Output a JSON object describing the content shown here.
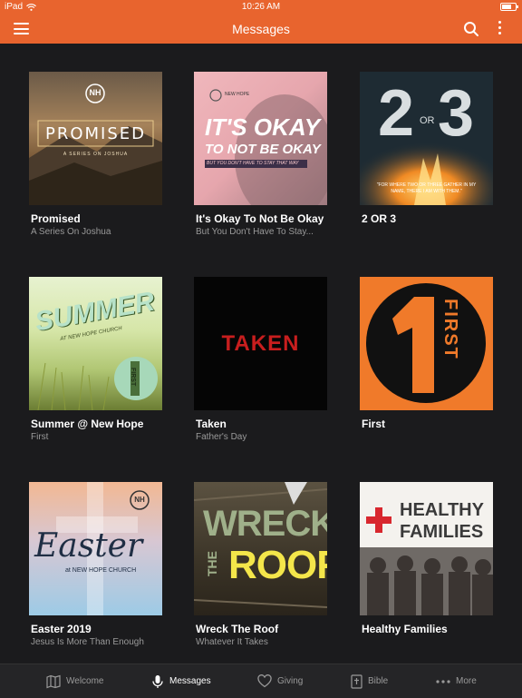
{
  "status_bar": {
    "device": "iPad",
    "time": "10:26 AM"
  },
  "header": {
    "title": "Messages"
  },
  "messages": [
    {
      "title": "Promised",
      "subtitle": "A Series On Joshua",
      "art_text": "PROMISED",
      "art_sub": "A SERIES ON JOSHUA",
      "logo": "NH"
    },
    {
      "title": "It's Okay To Not Be Okay",
      "subtitle": "But You Don't Have To Stay...",
      "art_text_1": "IT'S OKAY",
      "art_text_2": "TO NOT BE OKAY",
      "art_sub": "BUT YOU DON'T HAVE TO STAY THAT WAY",
      "logo_text": "NEW HOPE"
    },
    {
      "title": "2 OR 3",
      "subtitle": "",
      "art_num1": "2",
      "art_or": "OR",
      "art_num2": "3",
      "art_quote": "\"FOR WHERE TWO OR THREE GATHER IN MY NAME, THERE I AM WITH THEM.\""
    },
    {
      "title": "Summer @ New Hope",
      "subtitle": "First",
      "art_text": "SUMMER",
      "art_sub": "AT NEW HOPE CHURCH",
      "art_first": "FIRST"
    },
    {
      "title": "Taken",
      "subtitle": "Father's Day",
      "art_text": "TAKEN"
    },
    {
      "title": "First",
      "subtitle": "",
      "art_text": "FIRST"
    },
    {
      "title": "Easter 2019",
      "subtitle": "Jesus Is More Than Enough",
      "art_text": "Easter",
      "art_sub": "at NEW HOPE CHURCH",
      "logo": "NH"
    },
    {
      "title": "Wreck The Roof",
      "subtitle": "Whatever It Takes",
      "art_w1": "WRECK",
      "art_w2": "THE",
      "art_w3": "ROOF"
    },
    {
      "title": "Healthy Families",
      "subtitle": "",
      "art_w1": "HEALTHY",
      "art_w2": "FAMILIES"
    }
  ],
  "tabs": [
    {
      "label": "Welcome",
      "icon": "map-icon",
      "active": false
    },
    {
      "label": "Messages",
      "icon": "microphone-icon",
      "active": true
    },
    {
      "label": "Giving",
      "icon": "heart-icon",
      "active": false
    },
    {
      "label": "Bible",
      "icon": "bible-icon",
      "active": false
    },
    {
      "label": "More",
      "icon": "more-dots-icon",
      "active": false
    }
  ],
  "colors": {
    "accent": "#e8642e",
    "background": "#1b1b1d",
    "tabbar": "#252527"
  }
}
